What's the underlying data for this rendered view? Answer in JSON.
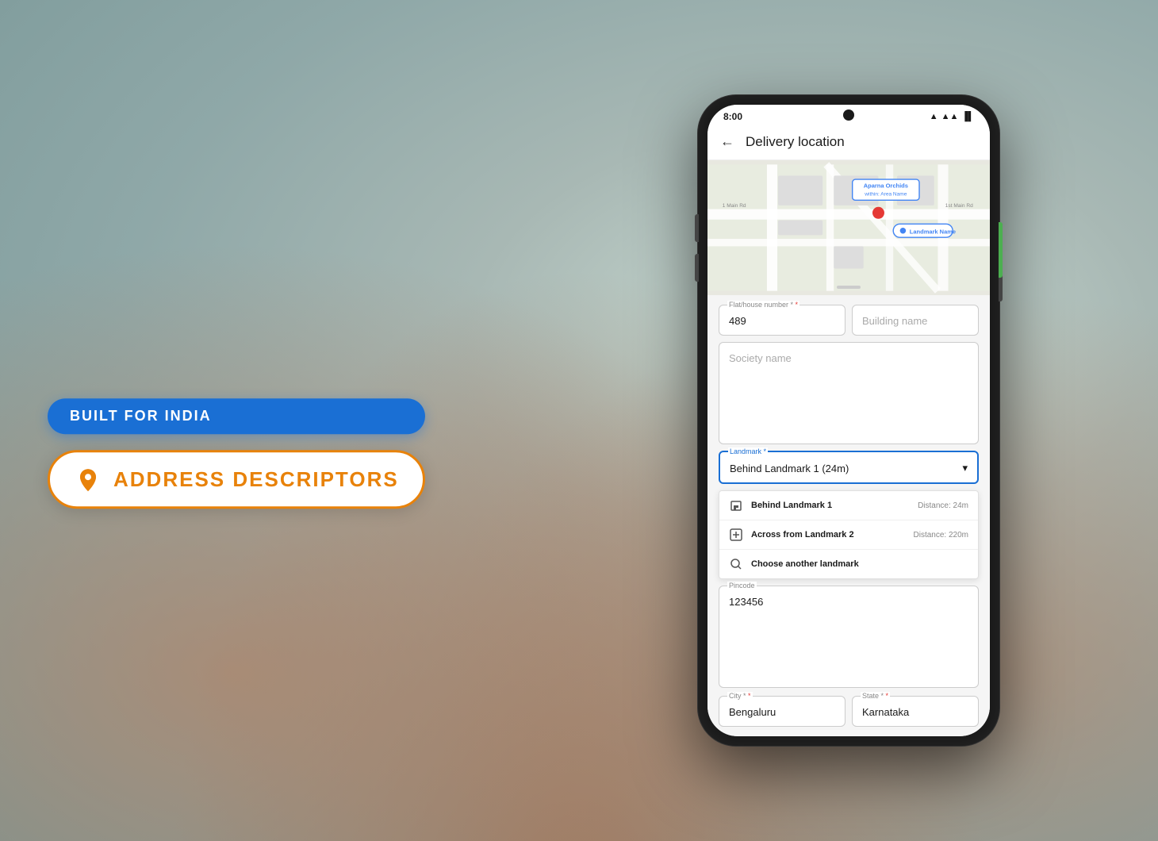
{
  "background": {
    "color": "#b0c4c8"
  },
  "badge_built_for_india": {
    "label": "BUILT FOR INDIA",
    "bg_color": "#1a6fd4",
    "text_color": "#ffffff"
  },
  "badge_address_descriptors": {
    "label": "ADDRESS DESCRIPTORS",
    "text_color": "#e8820a",
    "border_color": "#e8820a",
    "bg_color": "#ffffff",
    "icon": "📍"
  },
  "phone": {
    "status_bar": {
      "time": "8:00",
      "signal": "▲",
      "wifi": "WiFi",
      "battery": "🔋"
    },
    "header": {
      "back_arrow": "←",
      "title": "Delivery location"
    },
    "map": {
      "label_aparna": "Aparna Orchids",
      "sublabel": "within: Area Name",
      "landmark_name": "Landmark Name",
      "pin_color": "#e53935"
    },
    "form": {
      "flat_house_label": "Flat/house number *",
      "flat_house_value": "489",
      "building_name_placeholder": "Building name",
      "society_name_placeholder": "Society name",
      "landmark_label": "Landmark *",
      "landmark_value": "Behind Landmark 1 (24m)",
      "dropdown_options": [
        {
          "icon": "building",
          "name": "Behind Landmark 1",
          "distance": "Distance: 24m"
        },
        {
          "icon": "plus",
          "name": "Across from Landmark 2",
          "distance": "Distance: 220m"
        },
        {
          "icon": "search",
          "name": "Choose another landmark",
          "distance": ""
        }
      ],
      "pincode_label": "Pincode",
      "pincode_value": "123456",
      "city_label": "City *",
      "city_value": "Bengaluru",
      "state_label": "State *",
      "state_value": "Karnataka"
    }
  }
}
